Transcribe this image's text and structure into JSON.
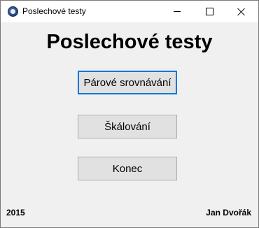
{
  "window": {
    "title": "Poslechové testy",
    "icon": "app-icon",
    "controls": [
      "minimize-icon",
      "maximize-icon",
      "close-icon"
    ]
  },
  "main": {
    "heading": "Poslechové testy",
    "buttons": [
      {
        "label": "Párové srovnávání",
        "focused": true
      },
      {
        "label": "Škálování",
        "focused": false
      },
      {
        "label": "Konec",
        "focused": false
      }
    ]
  },
  "footer": {
    "year": "2015",
    "author": "Jan Dvořák"
  },
  "colors": {
    "focus_border": "#0078d7",
    "button_bg": "#e1e1e1",
    "window_bg": "#f0f0f0"
  }
}
